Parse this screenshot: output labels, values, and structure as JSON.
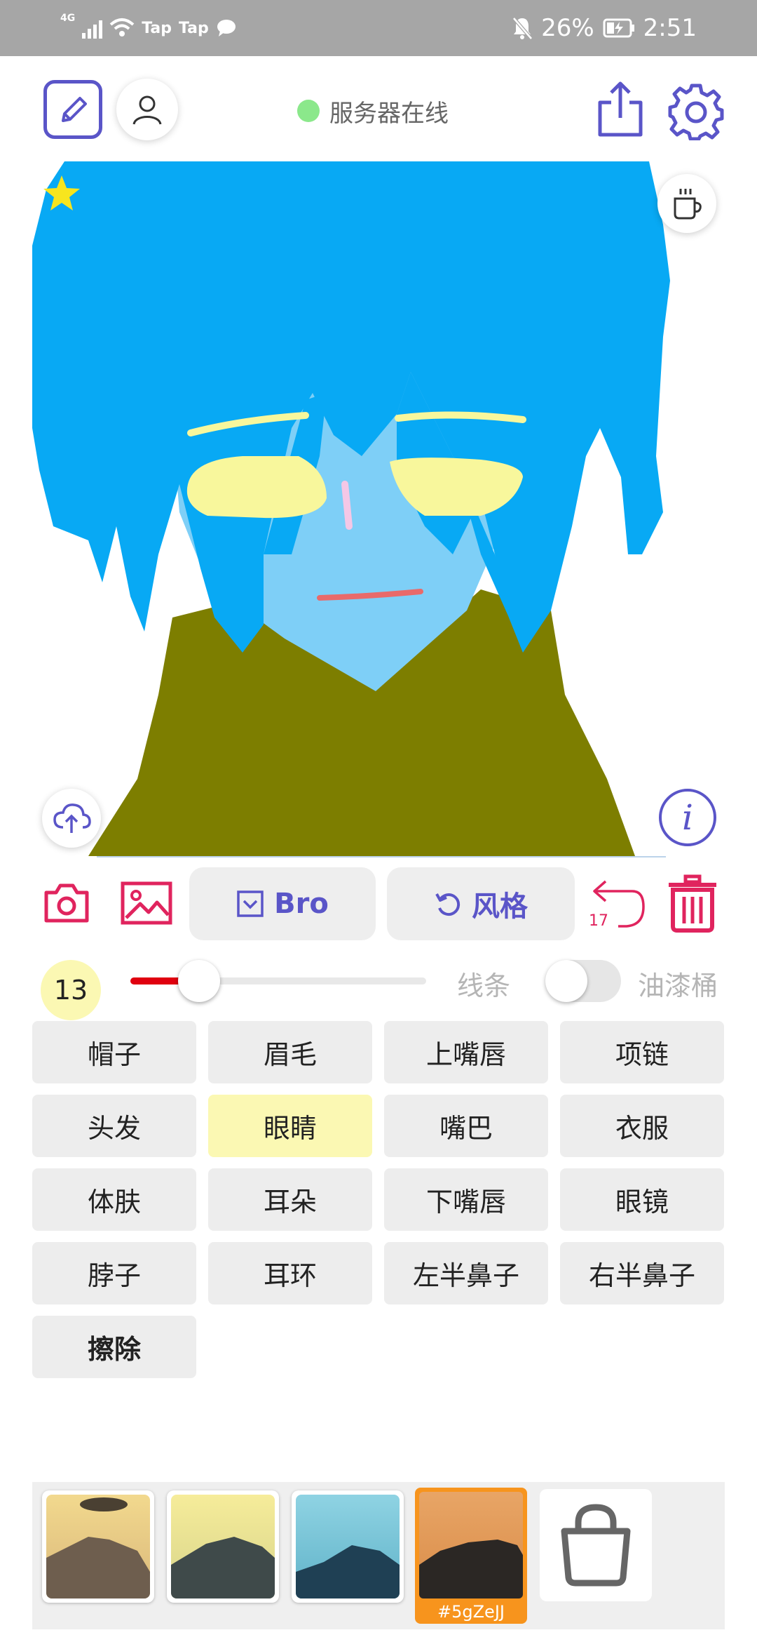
{
  "status_bar": {
    "network": "4G",
    "apps": [
      "Tap",
      "Tap"
    ],
    "battery": "26%",
    "time": "2:51"
  },
  "header": {
    "server_status": "服务器在线",
    "server_status_color": "#8be88b"
  },
  "colors": {
    "accent": "#5a55c8",
    "danger": "#e0245e",
    "selected_bg": "#fbf8b3",
    "hair": "#08a9f4",
    "skin": "#7ecff7",
    "glasses": "#f8f79c",
    "clothes": "#7d7e00"
  },
  "toolbar": {
    "bro_label": "Bro",
    "style_label": "风格",
    "undo_count": "17"
  },
  "brush": {
    "size": "13",
    "line_label": "线条",
    "bucket_label": "油漆桶",
    "bucket_enabled": false
  },
  "parts": [
    "帽子",
    "眉毛",
    "上嘴唇",
    "项链",
    "头发",
    "眼睛",
    "嘴巴",
    "衣服",
    "体肤",
    "耳朵",
    "下嘴唇",
    "眼镜",
    "脖子",
    "耳环",
    "左半鼻子",
    "右半鼻子",
    "擦除"
  ],
  "selected_part": "眼睛",
  "gallery": {
    "selected_code": "#5gZeJJ"
  }
}
